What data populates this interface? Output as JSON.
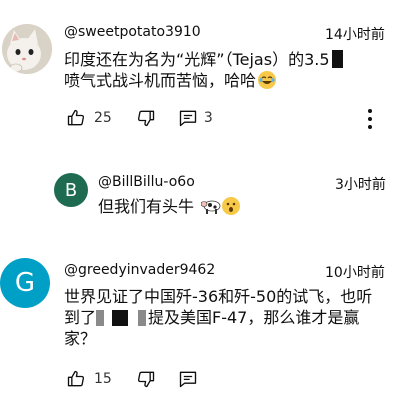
{
  "comments": [
    {
      "username": "@sweetpotato3910",
      "time": "14小时前",
      "text_part1": "印度还在为名为“光辉”（Tejas）的3.5",
      "text_part2": "喷气式战斗机而苦恼，哈哈",
      "likes": "25",
      "replies": "3"
    },
    {
      "username": "@BillBillu-o6o",
      "avatar_letter": "B",
      "avatar_color": "#1e6b52",
      "time": "3小时前",
      "text": "但我们有头牛"
    },
    {
      "username": "@greedyinvader9462",
      "avatar_letter": "G",
      "avatar_color": "#00a0c6",
      "time": "10小时前",
      "text_line1": "世界见证了中国歼-36和歼-50的试飞，也听",
      "text_line2_a": "到了",
      "text_line2_b": "提及美国F-47，那么谁才是赢",
      "text_line3": "家？",
      "likes": "15"
    }
  ],
  "colors": {
    "text": "#0f0f0f",
    "secondary": "#606060"
  }
}
